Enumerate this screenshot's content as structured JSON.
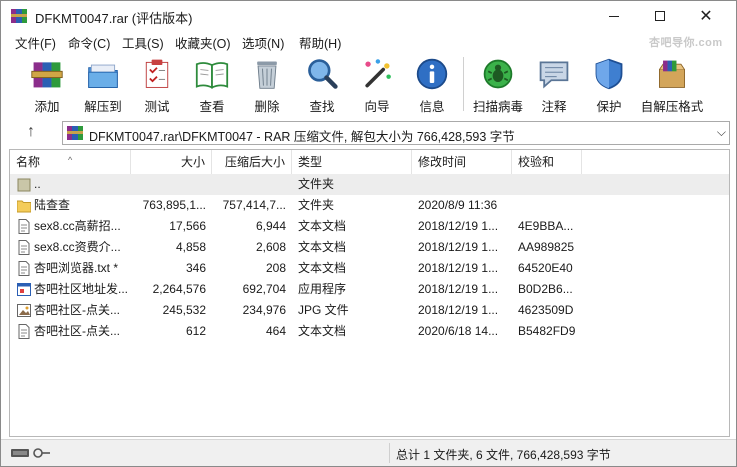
{
  "window": {
    "title": "DFKMT0047.rar (评估版本)",
    "minimize": "—",
    "maximize": "☐",
    "close": "✕"
  },
  "watermark": "杏吧导你.com",
  "menu": [
    "文件(F)",
    "命令(C)",
    "工具(S)",
    "收藏夹(O)",
    "选项(N)",
    "帮助(H)"
  ],
  "toolbar": [
    {
      "label": "添加",
      "icon": "add-archive-icon"
    },
    {
      "label": "解压到",
      "icon": "extract-to-icon"
    },
    {
      "label": "测试",
      "icon": "test-icon"
    },
    {
      "label": "查看",
      "icon": "view-book-icon"
    },
    {
      "label": "删除",
      "icon": "trash-icon"
    },
    {
      "label": "查找",
      "icon": "magnifier-icon"
    },
    {
      "label": "向导",
      "icon": "wizard-wand-icon"
    },
    {
      "label": "信息",
      "icon": "info-icon"
    },
    {
      "label": "扫描病毒",
      "icon": "virus-scan-icon"
    },
    {
      "label": "注释",
      "icon": "comment-icon"
    },
    {
      "label": "保护",
      "icon": "shield-icon"
    },
    {
      "label": "自解压格式",
      "icon": "sfx-box-icon"
    }
  ],
  "address": {
    "text": "DFKMT0047.rar\\DFKMT0047 - RAR 压缩文件, 解包大小为 766,428,593 字节"
  },
  "columns": [
    "名称",
    "大小",
    "压缩后大小",
    "类型",
    "修改时间",
    "校验和"
  ],
  "rows": [
    {
      "name": "..",
      "size": "",
      "packed": "",
      "type": "文件夹",
      "modified": "",
      "crc": "",
      "icon": "parent-folder-icon"
    },
    {
      "name": "陆查查",
      "size": "763,895,1...",
      "packed": "757,414,7...",
      "type": "文件夹",
      "modified": "2020/8/9 11:36",
      "crc": "",
      "icon": "folder-icon"
    },
    {
      "name": "sex8.cc高薪招...",
      "size": "17,566",
      "packed": "6,944",
      "type": "文本文档",
      "modified": "2018/12/19 1...",
      "crc": "4E9BBA...",
      "icon": "text-file-icon"
    },
    {
      "name": "sex8.cc资费介...",
      "size": "4,858",
      "packed": "2,608",
      "type": "文本文档",
      "modified": "2018/12/19 1...",
      "crc": "AA989825",
      "icon": "text-file-icon"
    },
    {
      "name": "杏吧浏览器.txt *",
      "size": "346",
      "packed": "208",
      "type": "文本文档",
      "modified": "2018/12/19 1...",
      "crc": "64520E40",
      "icon": "text-file-icon"
    },
    {
      "name": "杏吧社区地址发...",
      "size": "2,264,576",
      "packed": "692,704",
      "type": "应用程序",
      "modified": "2018/12/19 1...",
      "crc": "B0D2B6...",
      "icon": "application-icon"
    },
    {
      "name": "杏吧社区-点关...",
      "size": "245,532",
      "packed": "234,976",
      "type": "JPG 文件",
      "modified": "2018/12/19 1...",
      "crc": "4623509D",
      "icon": "image-file-icon"
    },
    {
      "name": "杏吧社区-点关...",
      "size": "612",
      "packed": "464",
      "type": "文本文档",
      "modified": "2020/6/18 14...",
      "crc": "B5482FD9",
      "icon": "text-file-icon"
    }
  ],
  "status": {
    "summary": "总计 1 文件夹, 6 文件, 766,428,593 字节"
  },
  "colors": {
    "selection": "#ededed",
    "status_bar": "#f0f0f0",
    "folder": "#f4cc5a"
  }
}
